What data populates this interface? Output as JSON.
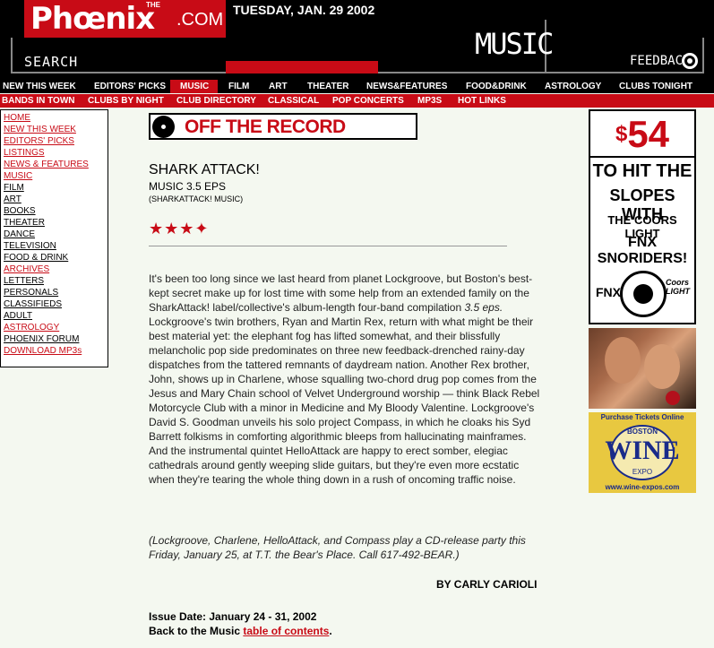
{
  "header": {
    "logo_text": "Phœnix",
    "logo_the": "THE",
    "logo_com": ".COM",
    "date": "TUESDAY, JAN. 29 2002",
    "search_label": "SEARCH",
    "section_title": "MUSIC",
    "feedback_label": "FEEDBACK"
  },
  "nav_primary": [
    {
      "label": "NEW THIS WEEK",
      "active": false
    },
    {
      "label": "EDITORS' PICKS",
      "active": false
    },
    {
      "label": "MUSIC",
      "active": true
    },
    {
      "label": "FILM",
      "active": false
    },
    {
      "label": "ART",
      "active": false
    },
    {
      "label": "THEATER",
      "active": false
    },
    {
      "label": "NEWS&FEATURES",
      "active": false
    },
    {
      "label": "FOOD&DRINK",
      "active": false
    },
    {
      "label": "ASTROLOGY",
      "active": false
    },
    {
      "label": "CLUBS TONIGHT",
      "active": false
    }
  ],
  "nav_secondary": [
    {
      "label": "BANDS IN TOWN"
    },
    {
      "label": "CLUBS BY NIGHT"
    },
    {
      "label": "CLUB DIRECTORY"
    },
    {
      "label": "CLASSICAL"
    },
    {
      "label": "POP CONCERTS"
    },
    {
      "label": "MP3S"
    },
    {
      "label": "HOT LINKS"
    }
  ],
  "sidebar": [
    {
      "label": "HOME",
      "color": "red"
    },
    {
      "label": "NEW THIS WEEK",
      "color": "red"
    },
    {
      "label": "EDITORS' PICKS",
      "color": "red"
    },
    {
      "label": "LISTINGS",
      "color": "red"
    },
    {
      "label": "NEWS & FEATURES",
      "color": "red"
    },
    {
      "label": "MUSIC",
      "color": "red"
    },
    {
      "label": "FILM",
      "color": "black"
    },
    {
      "label": "ART",
      "color": "black"
    },
    {
      "label": "BOOKS",
      "color": "black"
    },
    {
      "label": "THEATER",
      "color": "black"
    },
    {
      "label": "DANCE",
      "color": "black"
    },
    {
      "label": "TELEVISION",
      "color": "black"
    },
    {
      "label": "FOOD & DRINK",
      "color": "black"
    },
    {
      "label": "ARCHIVES",
      "color": "red"
    },
    {
      "label": "LETTERS",
      "color": "black"
    },
    {
      "label": "PERSONALS",
      "color": "black"
    },
    {
      "label": "CLASSIFIEDS",
      "color": "black"
    },
    {
      "label": "ADULT",
      "color": "black"
    },
    {
      "label": "ASTROLOGY",
      "color": "red"
    },
    {
      "label": "PHOENIX FORUM",
      "color": "black"
    },
    {
      "label": "DOWNLOAD MP3s",
      "color": "red"
    }
  ],
  "article": {
    "column_banner": "OFF THE RECORD",
    "title": "SHARK ATTACK!",
    "subtitle": "MUSIC 3.5 EPS",
    "label": "(SHARKATTACK! MUSIC)",
    "rating": 3.5,
    "stars_display": "★★★✦",
    "body_1": "It's been too long since we last heard from planet Lockgroove, but Boston's best-kept secret make up for lost time with some help from an extended family on the SharkAttack! label/collective's album-length four-band compilation ",
    "body_em": "3.5 eps.",
    "body_2": " Lockgroove's twin brothers, Ryan and Martin Rex, return with what might be their best material yet: the elephant fog has lifted somewhat, and their blissfully melancholic pop side predominates on three new feedback-drenched rainy-day dispatches from the tattered remnants of daydream nation. Another Rex brother, John, shows up in Charlene, whose squalling two-chord drug pop comes from the Jesus and Mary Chain school of Velvet Underground worship — think Black Rebel Motorcycle Club with a minor in Medicine and My Bloody Valentine. Lockgroove's David S. Goodman unveils his solo project Compass, in which he cloaks his Syd Barrett folkisms in comforting algorithmic bleeps from hallucinating mainframes. And the instrumental quintet HelloAttack are happy to erect somber, elegiac cathedrals around gently weeping slide guitars, but they're even more ecstatic when they're tearing the whole thing down in a rush of oncoming traffic noise.",
    "note": "(Lockgroove, Charlene, HelloAttack, and Compass play a CD-release party this Friday, January 25, at T.T. the Bear's Place. Call 617-492-BEAR.)",
    "byline": "BY CARLY CARIOLI",
    "issue_date": "Issue Date: January 24 - 31, 2002",
    "back_prefix": "Back to the Music ",
    "back_link": "table of contents",
    "back_suffix": "."
  },
  "ads": {
    "coors": {
      "currency": "$",
      "price": "54",
      "line1": "TO HIT THE",
      "line2": "SLOPES WITH",
      "line3": "THE COORS LIGHT",
      "line4": "FNX SNORIDERS!",
      "fnx": "FNX",
      "coors_light": "Coors LIGHT"
    },
    "wine": {
      "top": "Purchase Tickets Online",
      "boston": "BOSTON",
      "wine": "WINE",
      "expo": "EXPO",
      "url": "www.wine-expos.com"
    }
  },
  "colors": {
    "brand_red": "#c80b16",
    "background": "#f4f8f0",
    "black": "#000000"
  }
}
